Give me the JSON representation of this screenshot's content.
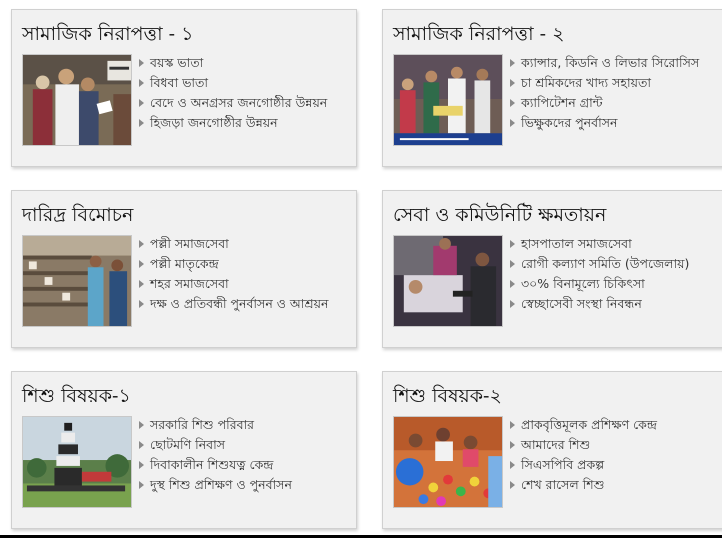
{
  "cards": [
    {
      "title": "সামাজিক নিরাপত্তা - ১",
      "image": "elderly-people-receiving-allowance-photo",
      "links": [
        "বয়স্ক ভাতা",
        "বিধবা ভাতা",
        "বেদে ও অনগ্রসর জনগোষ্ঠীর উন্নয়ন",
        "হিজড়া জনগোষ্ঠীর উন্নয়ন"
      ]
    },
    {
      "title": "সামাজিক নিরাপত্তা - ২",
      "image": "award-ceremony-photo",
      "links": [
        "ক্যান্সার, কিডনি ও লিভার সিরোসিস",
        "চা শ্রমিকদের খাদ্য সহায়তা",
        "ক্যাপিটেশন গ্রান্ট",
        "ভিক্ষুকদের পুনর্বাসন"
      ]
    },
    {
      "title": "দারিদ্র বিমোচন",
      "image": "poultry-farm-photo",
      "links": [
        "পল্লী সমাজসেবা",
        "পল্লী মাতৃকেন্দ্র",
        "শহর সমাজসেবা",
        "দক্ষ ও প্রতিবন্ধী পুনর্বাসন ও আশ্রয়ন"
      ]
    },
    {
      "title": "সেবা ও কমিউনিটি ক্ষমতায়ন",
      "image": "hospital-patient-photo",
      "links": [
        "হাসপাতাল সমাজসেবা",
        "রোগী কল্যাণ সমিতি (উপজেলায়)",
        "৩০% বিনামূল্যে চিকিৎসা",
        "স্বেচ্ছাসেবী সংস্থা নিবন্ধন"
      ]
    },
    {
      "title": "শিশু বিষয়ক-১",
      "image": "children-human-pyramid-photo",
      "links": [
        "সরকারি শিশু পরিবার",
        "ছোটমণি নিবাস",
        "দিবাকালীন শিশুযত্ন কেন্দ্র",
        "দুস্থ শিশু প্রশিক্ষণ ও পুনর্বাসন"
      ]
    },
    {
      "title": "শিশু বিষয়ক-২",
      "image": "children-ball-pit-photo",
      "links": [
        "প্রাকবৃত্তিমূলক প্রশিক্ষণ কেন্দ্র",
        "আমাদের শিশু",
        "সিএসপিবি প্রকল্প",
        "শেখ রাসেল শিশু"
      ]
    }
  ]
}
